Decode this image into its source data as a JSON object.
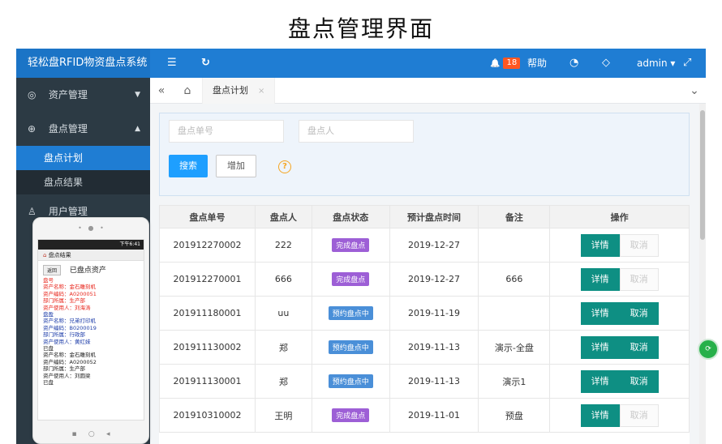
{
  "page_title": "盘点管理界面",
  "topbar": {
    "brand": "轻松盘RFID物资盘点系统",
    "menu_icon": "☰",
    "refresh_icon": "↻",
    "bell_icon": "🔔",
    "notification_count": "18",
    "help_label": "帮助",
    "dashboard_icon": "◔",
    "tag_icon": "◇",
    "user_label": "admin ▾",
    "fullscreen_icon": "⤢"
  },
  "sidebar": {
    "items": [
      {
        "icon": "◎",
        "label": "资产管理",
        "caret": "▼"
      },
      {
        "icon": "⊕",
        "label": "盘点管理",
        "caret": "▲"
      }
    ],
    "subitems": [
      {
        "label": "盘点计划"
      },
      {
        "label": "盘点结果"
      }
    ],
    "more_item": {
      "icon": "♙",
      "label": "用户管理"
    }
  },
  "tabbar": {
    "collapse_icon": "«",
    "home_icon": "⌂",
    "active_tab": "盘点计划",
    "close_icon": "×",
    "dropdown_icon": "⌄"
  },
  "search": {
    "order_placeholder": "盘点单号",
    "person_placeholder": "盘点人",
    "search_button": "搜索",
    "add_button": "增加",
    "help_icon": "?"
  },
  "table": {
    "headers": [
      "盘点单号",
      "盘点人",
      "盘点状态",
      "预计盘点时间",
      "备注",
      "操作"
    ],
    "detail_label": "详情",
    "cancel_label": "取消",
    "rows": [
      {
        "no": "201912270002",
        "person": "222",
        "status": "完成盘点",
        "date": "2019-12-27",
        "note": "",
        "cancel_enabled": false
      },
      {
        "no": "201912270001",
        "person": "666",
        "status": "完成盘点",
        "date": "2019-12-27",
        "note": "666",
        "cancel_enabled": false
      },
      {
        "no": "201911180001",
        "person": "uu",
        "status": "预约盘点中",
        "date": "2019-11-19",
        "note": "",
        "cancel_enabled": true
      },
      {
        "no": "201911130002",
        "person": "郑",
        "status": "预约盘点中",
        "date": "2019-11-13",
        "note": "演示-全盘",
        "cancel_enabled": true
      },
      {
        "no": "201911130001",
        "person": "郑",
        "status": "预约盘点中",
        "date": "2019-11-13",
        "note": "演示1",
        "cancel_enabled": true
      },
      {
        "no": "201910310002",
        "person": "王明",
        "status": "完成盘点",
        "date": "2019-11-01",
        "note": "预盘",
        "cancel_enabled": false
      }
    ]
  },
  "colors": {
    "done_status": "#9d5fd6",
    "pending_status": "#4a8fd8"
  },
  "phone": {
    "status_bar": "下午6:41",
    "header": "盘点结果",
    "back_label": "返回",
    "title": "已盘点资产",
    "lines": [
      {
        "text": "盘号",
        "color": "red"
      },
      {
        "text": "资产名称：金石雕刻机",
        "color": "red"
      },
      {
        "text": "资产编码：A0200051",
        "color": "red"
      },
      {
        "text": "部门所属：生产部",
        "color": "red"
      },
      {
        "text": "资产使用人：刘海涛",
        "color": "red"
      },
      {
        "text": "盘盈",
        "color": "blue"
      },
      {
        "text": "资产名称：兄弟打印机",
        "color": "blue"
      },
      {
        "text": "资产编码：B0200019",
        "color": "blue"
      },
      {
        "text": "部门所属：行政部",
        "color": "blue"
      },
      {
        "text": "资产使用人：黄红妹",
        "color": "blue"
      },
      {
        "text": "已盘",
        "color": "black"
      },
      {
        "text": "资产名称：金石雕刻机",
        "color": "black"
      },
      {
        "text": "资产编码：A0200052",
        "color": "black"
      },
      {
        "text": "部门所属：生产部",
        "color": "black"
      },
      {
        "text": "资产使用人：刘圆梁",
        "color": "black"
      },
      {
        "text": "已盘",
        "color": "black"
      }
    ]
  }
}
